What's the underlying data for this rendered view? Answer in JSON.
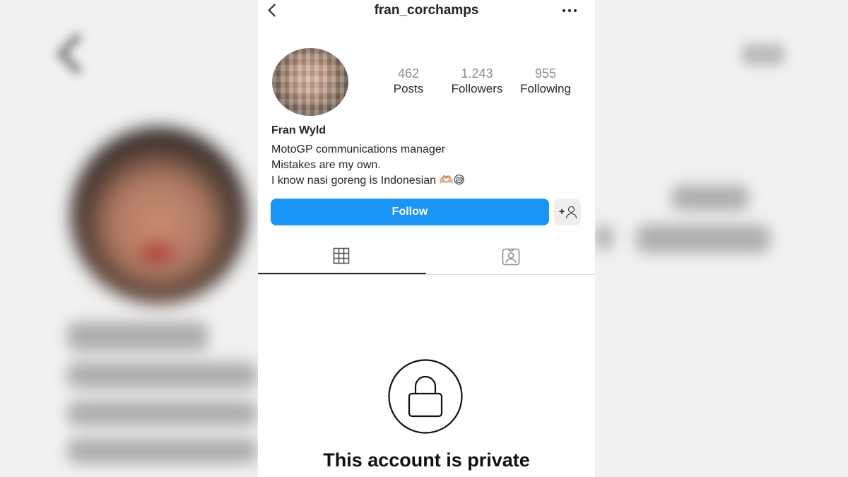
{
  "header": {
    "username": "fran_corchamps",
    "back_icon": "chevron-left-icon",
    "more_icon": "more-horizontal-icon"
  },
  "profile": {
    "avatar": "profile-photo",
    "stats": [
      {
        "value": "462",
        "label": "Posts"
      },
      {
        "value": "1.243",
        "label": "Followers"
      },
      {
        "value": "955",
        "label": "Following"
      }
    ],
    "name": "Fran Wyld",
    "bio": [
      "MotoGP communications manager",
      "Mistakes are my own.",
      "I know nasi goreng is Indonesian 🫶🏼😅"
    ]
  },
  "actions": {
    "follow_label": "Follow",
    "suggest_icon": "add-person-icon"
  },
  "tabs": [
    {
      "icon": "grid-icon",
      "active": true
    },
    {
      "icon": "tagged-icon",
      "active": false
    }
  ],
  "private": {
    "icon": "lock-icon",
    "title": "This account is private"
  },
  "colors": {
    "follow_button": "#1a95f5",
    "background": "#ffffff",
    "blurred_backdrop": "#f1f1f1"
  }
}
